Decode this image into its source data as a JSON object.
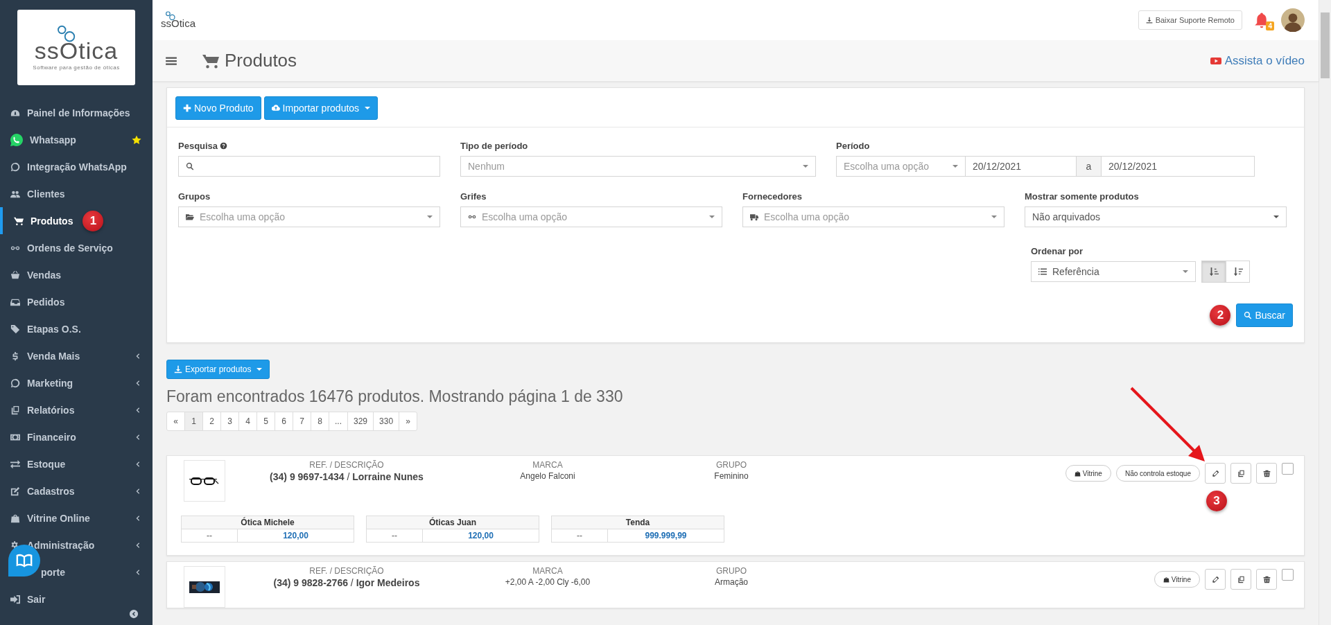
{
  "sidebar": {
    "logo": {
      "wordmark": "ssOtica",
      "tagline": "Software para gestão de óticas"
    },
    "items": [
      {
        "label": "Painel de Informações",
        "selected": false,
        "submenu": false,
        "favorite": false
      },
      {
        "label": "Whatsapp",
        "selected": false,
        "submenu": false,
        "favorite": true
      },
      {
        "label": "Integração WhatsApp",
        "selected": false,
        "submenu": false,
        "favorite": false
      },
      {
        "label": "Clientes",
        "selected": false,
        "submenu": false,
        "favorite": false
      },
      {
        "label": "Produtos",
        "selected": true,
        "submenu": false,
        "favorite": false,
        "marker": "1"
      },
      {
        "label": "Ordens de Serviço",
        "selected": false,
        "submenu": false,
        "favorite": false
      },
      {
        "label": "Vendas",
        "selected": false,
        "submenu": false,
        "favorite": false
      },
      {
        "label": "Pedidos",
        "selected": false,
        "submenu": false,
        "favorite": false
      },
      {
        "label": "Etapas O.S.",
        "selected": false,
        "submenu": false,
        "favorite": false
      },
      {
        "label": "Venda Mais",
        "selected": false,
        "submenu": true,
        "favorite": false
      },
      {
        "label": "Marketing",
        "selected": false,
        "submenu": true,
        "favorite": false
      },
      {
        "label": "Relatórios",
        "selected": false,
        "submenu": true,
        "favorite": false
      },
      {
        "label": "Financeiro",
        "selected": false,
        "submenu": true,
        "favorite": false
      },
      {
        "label": "Estoque",
        "selected": false,
        "submenu": true,
        "favorite": false
      },
      {
        "label": "Cadastros",
        "selected": false,
        "submenu": true,
        "favorite": false
      },
      {
        "label": "Vitrine Online",
        "selected": false,
        "submenu": true,
        "favorite": false
      },
      {
        "label": "Administração",
        "selected": false,
        "submenu": true,
        "favorite": false
      },
      {
        "label": "porte",
        "selected": false,
        "submenu": true,
        "favorite": false
      },
      {
        "label": "Sair",
        "selected": false,
        "submenu": false,
        "favorite": false
      }
    ]
  },
  "topbar": {
    "brand": "ssOtica",
    "support_button": "Baixar Suporte Remoto",
    "notifications": "4"
  },
  "header": {
    "title": "Produtos",
    "video_link": "Assista o vídeo"
  },
  "filters": {
    "buttons": [
      {
        "label": "Novo Produto",
        "kind": "new",
        "dropdown": false
      },
      {
        "label": "Importar produtos",
        "kind": "import",
        "dropdown": true
      }
    ],
    "search": {
      "label": "Pesquisa"
    },
    "period_type": {
      "label": "Tipo de período",
      "placeholder": "Nenhum"
    },
    "period": {
      "label": "Período",
      "placeholder": "Escolha uma opção",
      "start": "20/12/2021",
      "separator": "a",
      "end": "20/12/2021"
    },
    "groups": {
      "label": "Grupos",
      "placeholder": "Escolha uma opção"
    },
    "brands": {
      "label": "Grifes",
      "placeholder": "Escolha uma opção"
    },
    "suppliers": {
      "label": "Fornecedores",
      "placeholder": "Escolha uma opção"
    },
    "show_only": {
      "label": "Mostrar somente produtos",
      "value": "Não arquivados"
    },
    "sort": {
      "label": "Ordenar por",
      "value": "Referência",
      "directions": [
        {
          "kind": "asc",
          "selected": true
        },
        {
          "kind": "desc",
          "selected": false
        }
      ]
    },
    "search_button": "Buscar",
    "marker": "2"
  },
  "results": {
    "export_button": "Exportar produtos",
    "summary": "Foram encontrados 16476 produtos. Mostrando página 1 de 330",
    "pages": [
      {
        "label": "«",
        "selected": false
      },
      {
        "label": "1",
        "selected": true
      },
      {
        "label": "2",
        "selected": false
      },
      {
        "label": "3",
        "selected": false
      },
      {
        "label": "4",
        "selected": false
      },
      {
        "label": "5",
        "selected": false
      },
      {
        "label": "6",
        "selected": false
      },
      {
        "label": "7",
        "selected": false
      },
      {
        "label": "8",
        "selected": false
      },
      {
        "label": "...",
        "selected": false
      },
      {
        "label": "329",
        "selected": false
      },
      {
        "label": "330",
        "selected": false
      },
      {
        "label": "»",
        "selected": false
      }
    ]
  },
  "products": [
    {
      "image": {
        "kind": "picture"
      },
      "ref_label": "REF. / DESCRIÇÃO",
      "ref": "(34) 9 9697-1434",
      "ref_separator": "/",
      "name": "Lorraine Nunes",
      "brand_label": "MARCA",
      "brand": "Angelo Falconi",
      "group_label": "GRUPO",
      "group": "Feminino",
      "tags": [
        "Vitrine",
        "Não controla estoque"
      ],
      "checked": false,
      "marker": "3",
      "stores": [
        {
          "name": "Ótica Michele",
          "stock": "--",
          "price": "120,00"
        },
        {
          "name": "Óticas Juan",
          "stock": "--",
          "price": "120,00"
        },
        {
          "name": "Tenda",
          "stock": "--",
          "price": "999.999,99"
        }
      ]
    },
    {
      "image": {
        "kind": "picture"
      },
      "ref_label": "REF. / DESCRIÇÃO",
      "ref": "(34) 9 9828-2766",
      "ref_separator": "/",
      "name": "Igor Medeiros",
      "brand_label": "MARCA",
      "brand": "+2,00 A -2,00 Cly -6,00",
      "group_label": "GRUPO",
      "group": "Armação",
      "tags": [
        "Vitrine"
      ],
      "checked": false
    }
  ]
}
